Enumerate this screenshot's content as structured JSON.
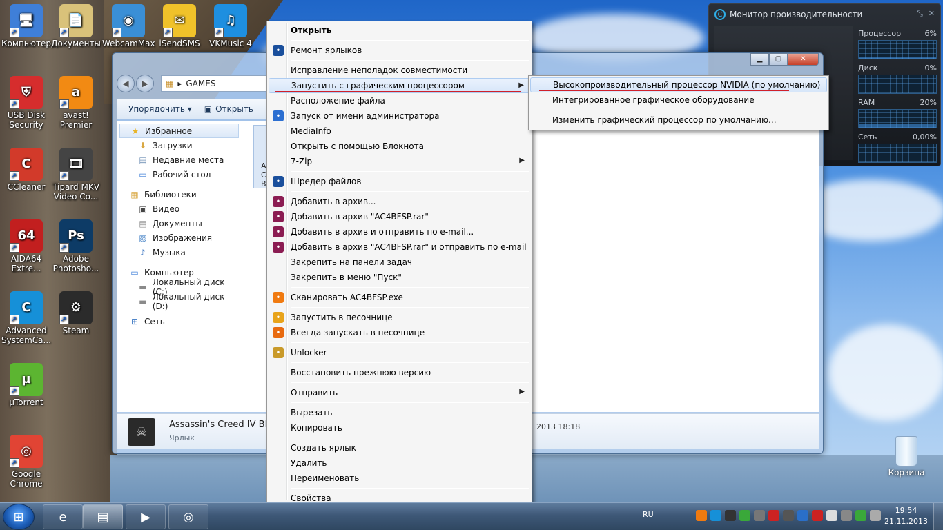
{
  "desktop": {
    "icons": [
      {
        "label": "Компьютер",
        "icon": "computer-icon",
        "color": "#3f7fd8"
      },
      {
        "label": "Документы",
        "icon": "documents-icon",
        "color": "#d9c27a"
      },
      {
        "label": "WebcamMax",
        "icon": "webcam-icon",
        "color": "#3a8fd6"
      },
      {
        "label": "iSendSMS",
        "icon": "sms-icon",
        "color": "#f0c22a"
      },
      {
        "label": "VKMusic 4",
        "icon": "music-icon",
        "color": "#1e8fe0"
      },
      {
        "label": "USB Disk Security",
        "icon": "shield-icon",
        "color": "#d62d2d"
      },
      {
        "label": "avast! Premier",
        "icon": "avast-icon",
        "color": "#f28a13"
      },
      {
        "label": "CCleaner",
        "icon": "ccleaner-icon",
        "color": "#d23a2a"
      },
      {
        "label": "Tipard MKV Video Co...",
        "icon": "film-icon",
        "color": "#444444"
      },
      {
        "label": "AIDA64 Extre...",
        "icon": "aida-icon",
        "color": "#c21f1f"
      },
      {
        "label": "Adobe Photosho...",
        "icon": "photoshop-icon",
        "color": "#0d3b66"
      },
      {
        "label": "Advanced SystemCa...",
        "icon": "advanced-systemcare-icon",
        "color": "#1690d8"
      },
      {
        "label": "Steam",
        "icon": "steam-icon",
        "color": "#2b2b2b"
      },
      {
        "label": "µTorrent",
        "icon": "utorrent-icon",
        "color": "#5cb531"
      },
      {
        "label": "Google Chrome",
        "icon": "chrome-icon",
        "color": "#e14434"
      }
    ],
    "icon_glyphs": [
      "🖥",
      "📄",
      "◉",
      "✉",
      "♫",
      "⛨",
      "a",
      "C",
      "🎞",
      "64",
      "Ps",
      "C",
      "⚙",
      "µ",
      "◎"
    ],
    "recycle_bin": "Корзина"
  },
  "explorer": {
    "address": "GAMES",
    "address_sep": "▸",
    "toolbar": {
      "organize": "Упорядочить ▾",
      "open": "Открыть"
    },
    "nav": [
      {
        "label": "Избранное",
        "level": "group",
        "icon": "star-icon",
        "glyph": "★",
        "color": "#e8b428",
        "selected": true
      },
      {
        "label": "Загрузки",
        "level": "sub",
        "icon": "downloads-folder-icon",
        "glyph": "⬇",
        "color": "#d9a843"
      },
      {
        "label": "Недавние места",
        "level": "sub",
        "icon": "recent-places-icon",
        "glyph": "▤",
        "color": "#6e8fb5"
      },
      {
        "label": "Рабочий стол",
        "level": "sub",
        "icon": "desktop-folder-icon",
        "glyph": "▭",
        "color": "#3f7fd8"
      },
      {
        "label": "Библиотеки",
        "level": "group",
        "icon": "libraries-icon",
        "glyph": "▦",
        "color": "#d9a843"
      },
      {
        "label": "Видео",
        "level": "sub",
        "icon": "video-icon",
        "glyph": "▣",
        "color": "#444"
      },
      {
        "label": "Документы",
        "level": "sub",
        "icon": "documents-lib-icon",
        "glyph": "▤",
        "color": "#8a8a8a"
      },
      {
        "label": "Изображения",
        "level": "sub",
        "icon": "pictures-icon",
        "glyph": "▨",
        "color": "#4b86c8"
      },
      {
        "label": "Музыка",
        "level": "sub",
        "icon": "music-note-icon",
        "glyph": "♪",
        "color": "#3a76c2"
      },
      {
        "label": "Компьютер",
        "level": "group",
        "icon": "computer-icon",
        "glyph": "▭",
        "color": "#3f7fd8"
      },
      {
        "label": "Локальный диск (C:)",
        "level": "sub",
        "icon": "drive-c-icon",
        "glyph": "▬",
        "color": "#8a8a8a"
      },
      {
        "label": "Локальный диск (D:)",
        "level": "sub",
        "icon": "drive-d-icon",
        "glyph": "▬",
        "color": "#8a8a8a"
      },
      {
        "label": "Сеть",
        "level": "group",
        "icon": "network-icon",
        "glyph": "⊞",
        "color": "#3a76c2"
      }
    ],
    "file_tile": "A\nC\nBl",
    "details": {
      "name": "Assassin's Creed IV Blac",
      "type": "Ярлык",
      "date": "2013 18:18"
    }
  },
  "context_menu": {
    "items": [
      {
        "label": "Открыть",
        "bold": true
      },
      {
        "sep": true
      },
      {
        "label": "Ремонт ярлыков",
        "icon": "repair-shortcut-icon",
        "color": "#1a4f9c"
      },
      {
        "sep": true
      },
      {
        "label": "Исправление неполадок совместимости"
      },
      {
        "label": "Запустить с графическим процессором",
        "submenu": true,
        "highlight": true
      },
      {
        "label": "Расположение файла"
      },
      {
        "label": "Запуск от имени администратора",
        "icon": "uac-shield-icon",
        "color": "#2c6fd1"
      },
      {
        "label": "MediaInfo"
      },
      {
        "label": "Открыть с помощью Блокнота"
      },
      {
        "label": "7-Zip",
        "submenu": true
      },
      {
        "sep": true
      },
      {
        "label": "Шредер файлов",
        "icon": "shredder-icon",
        "color": "#1a4f9c"
      },
      {
        "sep": true
      },
      {
        "label": "Добавить в архив...",
        "icon": "winrar-icon",
        "color": "#8b1c52"
      },
      {
        "label": "Добавить в архив \"AC4BFSP.rar\"",
        "icon": "winrar-icon",
        "color": "#8b1c52"
      },
      {
        "label": "Добавить в архив и отправить по e-mail...",
        "icon": "winrar-icon",
        "color": "#8b1c52"
      },
      {
        "label": "Добавить в архив \"AC4BFSP.rar\" и отправить по e-mail",
        "icon": "winrar-icon",
        "color": "#8b1c52"
      },
      {
        "label": "Закрепить на панели задач"
      },
      {
        "label": "Закрепить в меню \"Пуск\""
      },
      {
        "sep": true
      },
      {
        "label": "Сканировать AC4BFSP.exe",
        "icon": "avast-scan-icon",
        "color": "#f07a10"
      },
      {
        "sep": true
      },
      {
        "label": "Запустить в песочнице",
        "icon": "sandbox-lock-icon",
        "color": "#e8a31a"
      },
      {
        "label": "Всегда запускать в песочнице",
        "icon": "sandbox-play-icon",
        "color": "#e86a10"
      },
      {
        "sep": true
      },
      {
        "label": "Unlocker",
        "icon": "unlocker-wand-icon",
        "color": "#c99a2a"
      },
      {
        "sep": true
      },
      {
        "label": "Восстановить прежнюю версию"
      },
      {
        "sep": true
      },
      {
        "label": "Отправить",
        "submenu": true
      },
      {
        "sep": true
      },
      {
        "label": "Вырезать"
      },
      {
        "label": "Копировать"
      },
      {
        "sep": true
      },
      {
        "label": "Создать ярлык"
      },
      {
        "label": "Удалить"
      },
      {
        "label": "Переименовать"
      },
      {
        "sep": true
      },
      {
        "label": "Свойства"
      }
    ]
  },
  "gpu_submenu": {
    "items": [
      {
        "label": "Высокопроизводительный процессор NVIDIA (по умолчанию)",
        "highlight": true
      },
      {
        "label": "Интегрированное графическое оборудование"
      },
      {
        "sep": true
      },
      {
        "label": "Изменить графический процессор по умолчанию..."
      }
    ]
  },
  "perf_monitor": {
    "title": "Монитор производительности",
    "controls": [
      "⤡",
      "✕"
    ],
    "rows": [
      {
        "label": "Процессор",
        "value": "6%",
        "fraction": 0.06
      },
      {
        "label": "Диск",
        "value": "0%",
        "fraction": 0.0
      },
      {
        "label": "RAM",
        "value": "20%",
        "fraction": 0.2
      },
      {
        "label": "Сеть",
        "value": "0,00%",
        "fraction": 0.0
      }
    ]
  },
  "taskbar": {
    "language": "RU",
    "time": "19:54",
    "date": "21.11.2013",
    "apps": [
      {
        "name": "ie",
        "glyph": "e",
        "active": false
      },
      {
        "name": "explorer",
        "glyph": "▤",
        "active": true
      },
      {
        "name": "media-player",
        "glyph": "▶",
        "active": false
      },
      {
        "name": "chrome",
        "glyph": "◎",
        "active": false
      }
    ],
    "tray": [
      {
        "icon": "avast-tray-icon",
        "color": "#f07a10"
      },
      {
        "icon": "advanced-systemcare-tray-icon",
        "color": "#1690d8"
      },
      {
        "icon": "nvidia-tray-icon",
        "color": "#333"
      },
      {
        "icon": "checkmark-tray-icon",
        "color": "#3aa83a"
      },
      {
        "icon": "tool-tray-icon",
        "color": "#777"
      },
      {
        "icon": "volume-mute-tray-icon",
        "color": "#c22"
      },
      {
        "icon": "volume-tray-icon",
        "color": "#555"
      },
      {
        "icon": "grid-tray-icon",
        "color": "#2a6fc9"
      },
      {
        "icon": "shield-tray-icon",
        "color": "#c22"
      },
      {
        "icon": "flag-tray-icon",
        "color": "#ddd"
      },
      {
        "icon": "usb-tray-icon",
        "color": "#888"
      },
      {
        "icon": "signal-tray-icon",
        "color": "#3aa83a"
      },
      {
        "icon": "speaker-tray-icon",
        "color": "#aaa"
      }
    ]
  }
}
